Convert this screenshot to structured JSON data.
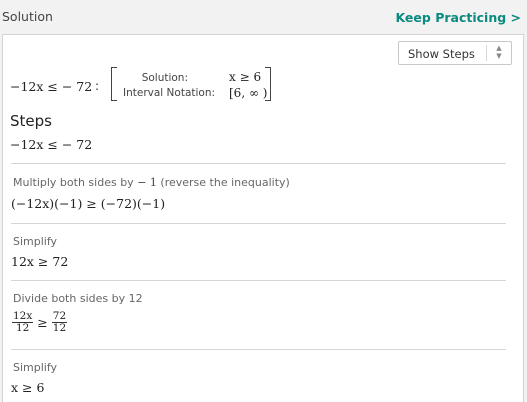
{
  "header": {
    "title": "Solution",
    "keep_practicing": "Keep Practicing >"
  },
  "show_steps": {
    "label": "Show Steps",
    "arrows_up": "▲",
    "arrows_down": "▼"
  },
  "summary": {
    "expression": "−12x ≤  − 72",
    "separator": ":",
    "solution_label": "Solution:",
    "solution_value": "x ≥ 6",
    "interval_label": "Interval Notation:",
    "interval_value": "[6, ∞ )"
  },
  "steps": {
    "heading": "Steps",
    "initial_expression": "−12x ≤  − 72",
    "items": [
      {
        "label_prefix": "Multiply both sides by",
        "label_value": "− 1",
        "label_suffix": "(reverse the inequality)",
        "expression": "(−12x)(−1) ≥ (−72)(−1)"
      },
      {
        "label": "Simplify",
        "expression": "12x ≥ 72"
      },
      {
        "label": "Divide both sides by 12",
        "frac_left_num": "12x",
        "frac_left_den": "12",
        "relation": "≥",
        "frac_right_num": "72",
        "frac_right_den": "12"
      },
      {
        "label": "Simplify",
        "expression": "x ≥ 6"
      }
    ]
  }
}
